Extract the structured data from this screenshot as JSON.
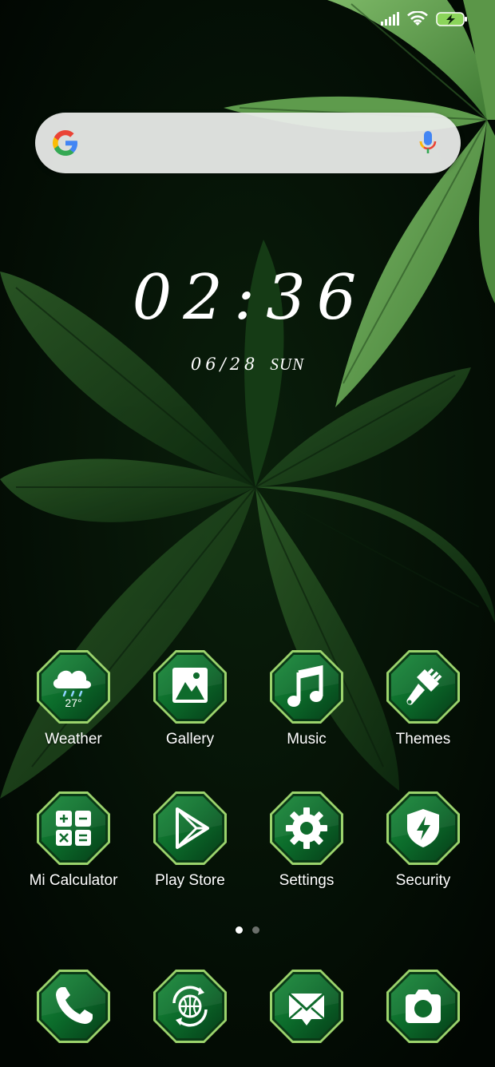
{
  "status_bar": {
    "icons": [
      "signal-icon",
      "wifi-icon",
      "battery-charging-icon"
    ]
  },
  "search": {
    "logo": "google-logo",
    "mic_icon": "mic-icon"
  },
  "clock": {
    "time": "02:36",
    "date": "06/28",
    "weekday": "SUN"
  },
  "apps_row1": [
    {
      "label": "Weather",
      "icon": "weather-cloud-icon",
      "temp": "27°"
    },
    {
      "label": "Gallery",
      "icon": "gallery-icon"
    },
    {
      "label": "Music",
      "icon": "music-icon"
    },
    {
      "label": "Themes",
      "icon": "themes-brush-icon"
    }
  ],
  "apps_row2": [
    {
      "label": "Mi Calculator",
      "icon": "calculator-icon"
    },
    {
      "label": "Play Store",
      "icon": "play-store-icon"
    },
    {
      "label": "Settings",
      "icon": "settings-gear-icon"
    },
    {
      "label": "Security",
      "icon": "security-shield-icon"
    }
  ],
  "pager": {
    "pages": 2,
    "current": 1
  },
  "dock": [
    {
      "icon": "phone-icon"
    },
    {
      "icon": "browser-globe-icon"
    },
    {
      "icon": "messages-icon"
    },
    {
      "icon": "camera-icon"
    }
  ],
  "colors": {
    "background": "#020a04",
    "leaf_dark": "#1f4a1c",
    "leaf_light": "#6aa653",
    "icon_green": "#0f6b2c",
    "icon_rim": "#9bd36c"
  }
}
